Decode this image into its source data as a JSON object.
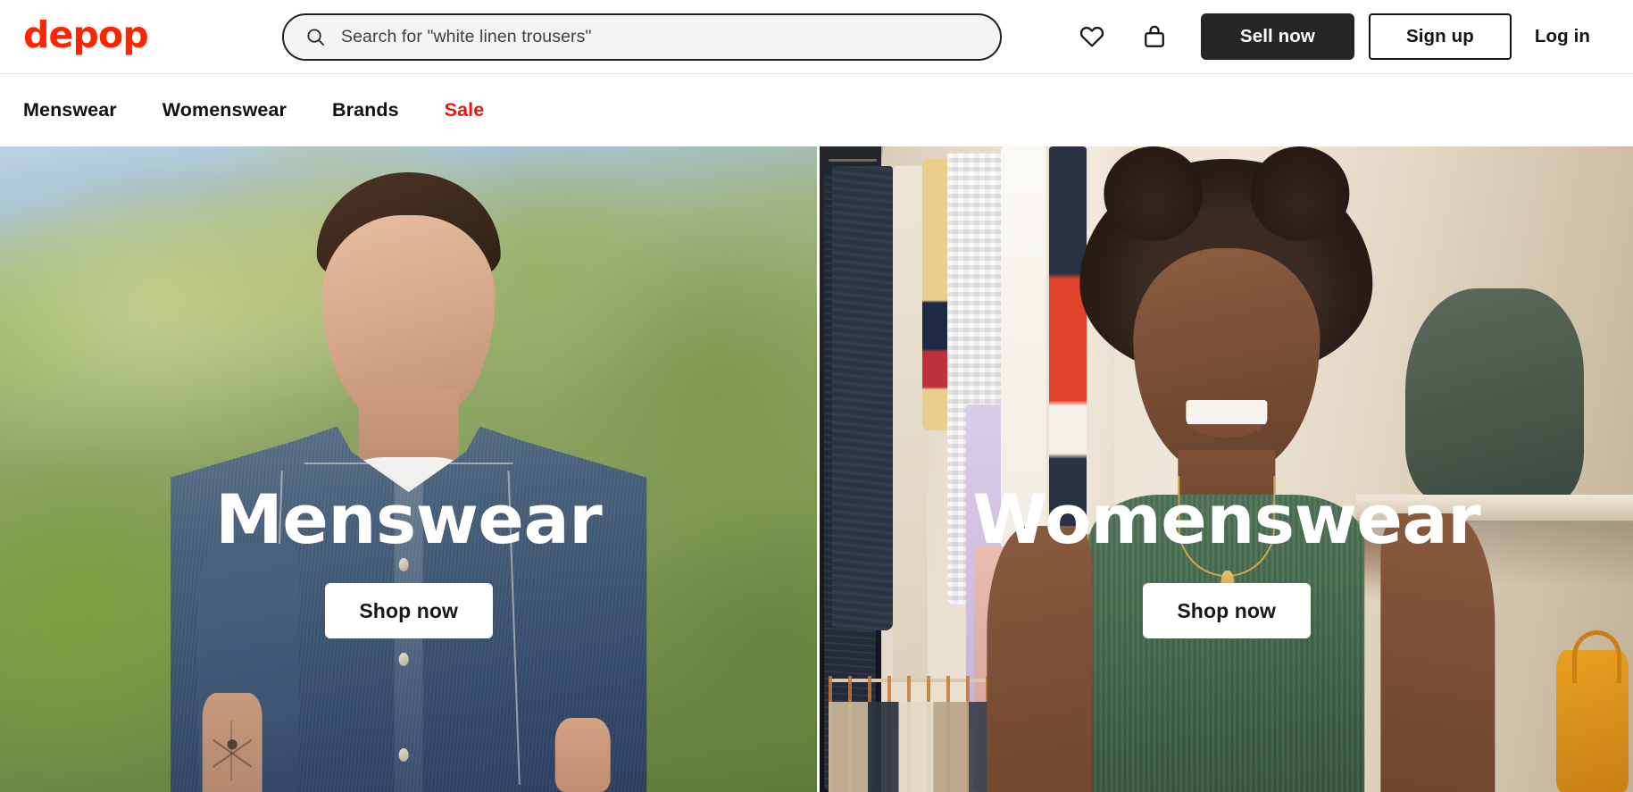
{
  "brand": {
    "logo_text": "depop",
    "logo_color": "#ff2300",
    "accent_red": "#e01a10",
    "dark": "#262626"
  },
  "header": {
    "search": {
      "placeholder": "Search for \"white linen trousers\"",
      "value": "",
      "icon": "search-icon"
    },
    "icons": [
      {
        "name": "heart-icon",
        "label": "Saved items"
      },
      {
        "name": "bag-icon",
        "label": "Bag"
      }
    ],
    "sell_button": "Sell now",
    "signup_button": "Sign up",
    "login_button": "Log in"
  },
  "nav": {
    "items": [
      {
        "label": "Menswear",
        "highlight": false
      },
      {
        "label": "Womenswear",
        "highlight": false
      },
      {
        "label": "Brands",
        "highlight": false
      },
      {
        "label": "Sale",
        "highlight": true
      }
    ]
  },
  "hero": {
    "cards": [
      {
        "title": "Menswear",
        "cta": "Shop now",
        "image_alt": "Man in denim jacket and white tee standing outdoors with blurred palm foliage"
      },
      {
        "title": "Womenswear",
        "cta": "Shop now",
        "image_alt": "Smiling woman in green ribbed tank top in front of a wardrobe of hanging clothes"
      }
    ]
  }
}
